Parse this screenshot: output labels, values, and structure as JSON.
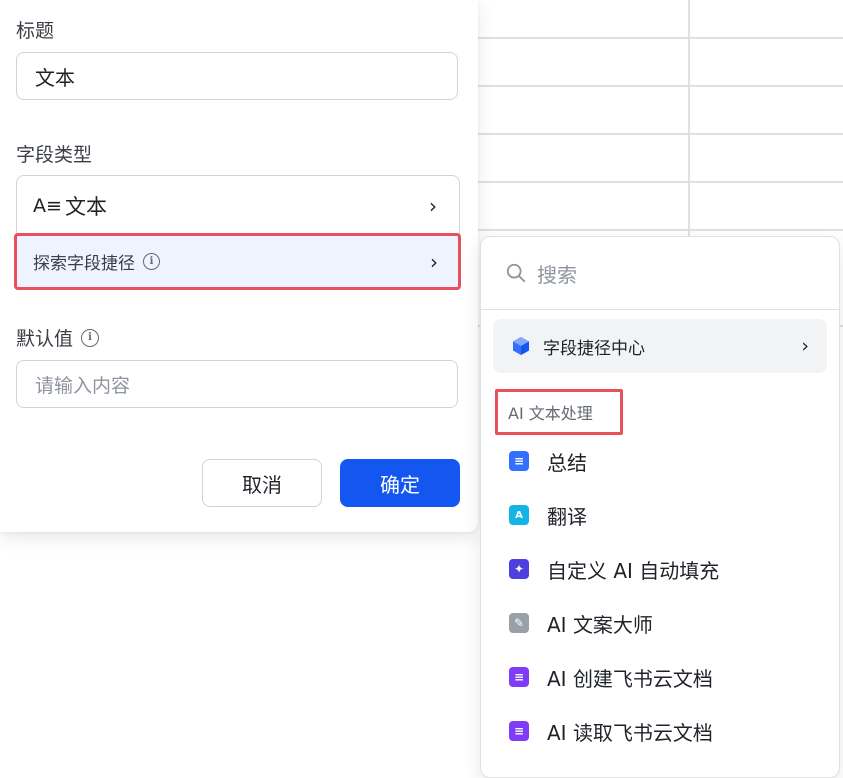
{
  "form": {
    "title_label": "标题",
    "title_value": "文本",
    "field_type_label": "字段类型",
    "field_type_icon_text": "A≡",
    "field_type_value": "文本",
    "explore_shortcut_label": "探索字段捷径",
    "default_value_label": "默认值",
    "default_value_placeholder": "请输入内容",
    "cancel_label": "取消",
    "confirm_label": "确定"
  },
  "dropdown": {
    "search_placeholder": "搜索",
    "shortcut_center_label": "字段捷径中心",
    "section_header": "AI 文本处理",
    "items": [
      {
        "label": "总结",
        "icon": "summary-icon",
        "color": "#3370ff"
      },
      {
        "label": "翻译",
        "icon": "translate-icon",
        "color": "#14b4e6"
      },
      {
        "label": "自定义 AI 自动填充",
        "icon": "sparkle-icon",
        "color": "#4e3fe0"
      },
      {
        "label": "AI 文案大师",
        "icon": "copywriter-icon",
        "color": "#9aa0a8"
      },
      {
        "label": "AI 创建飞书云文档",
        "icon": "create-doc-icon",
        "color": "#7f3bf5"
      },
      {
        "label": "AI 读取飞书云文档",
        "icon": "read-doc-icon",
        "color": "#7f3bf5"
      }
    ]
  },
  "colors": {
    "primary": "#1456f0",
    "highlight_border": "#e8505b",
    "shortcut_bg": "#eef3ff"
  }
}
